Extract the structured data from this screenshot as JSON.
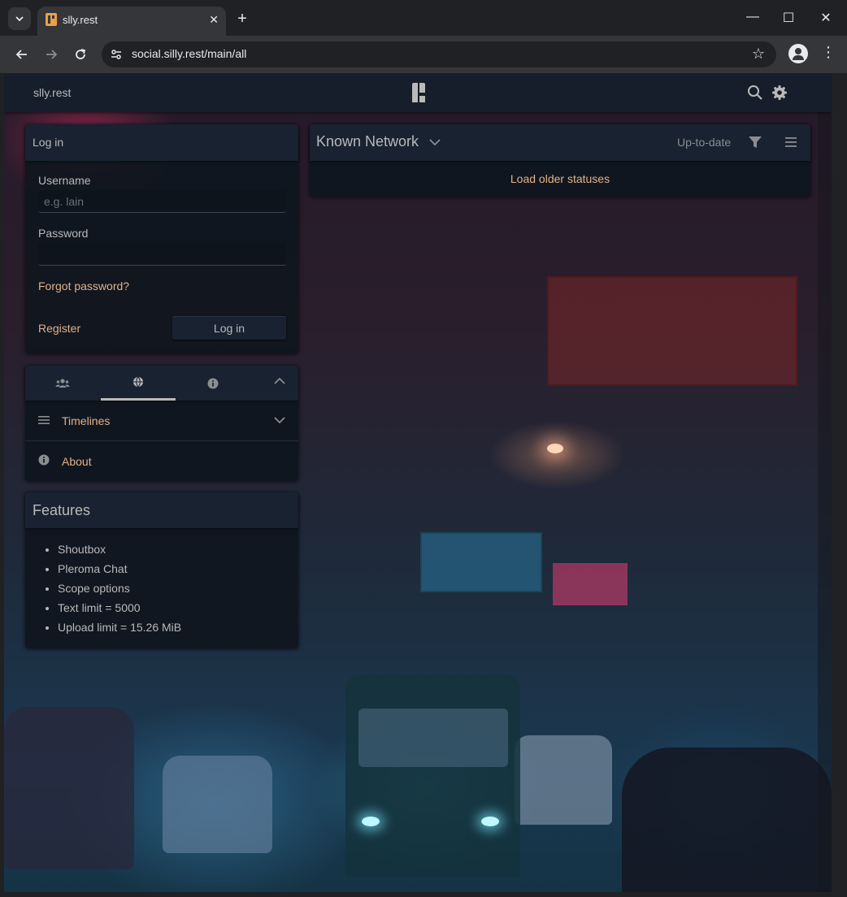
{
  "browser": {
    "tab_title": "slly.rest",
    "url": "social.silly.rest/main/all"
  },
  "app": {
    "title": "slly.rest"
  },
  "login": {
    "heading": "Log in",
    "username_label": "Username",
    "username_placeholder": "e.g. lain",
    "username_value": "",
    "password_label": "Password",
    "password_value": "",
    "forgot_link": "Forgot password?",
    "register_link": "Register",
    "login_button": "Log in"
  },
  "nav": {
    "tabs": [
      {
        "icon": "users-icon",
        "active": false
      },
      {
        "icon": "globe-icon",
        "active": true
      },
      {
        "icon": "info-icon",
        "active": false
      }
    ],
    "items": [
      {
        "label": "Timelines",
        "icon": "bars-icon"
      },
      {
        "label": "About",
        "icon": "info-circle-icon"
      }
    ]
  },
  "features": {
    "heading": "Features",
    "items": [
      "Shoutbox",
      "Pleroma Chat",
      "Scope options",
      "Text limit = 5000",
      "Upload limit = 15.26 MiB"
    ]
  },
  "timeline": {
    "title": "Known Network",
    "status": "Up-to-date",
    "load_older": "Load older statuses"
  },
  "colors": {
    "accent": "#e2b188",
    "panel": "#0f161e",
    "header": "#151e2a",
    "text": "#b9b9ba"
  }
}
